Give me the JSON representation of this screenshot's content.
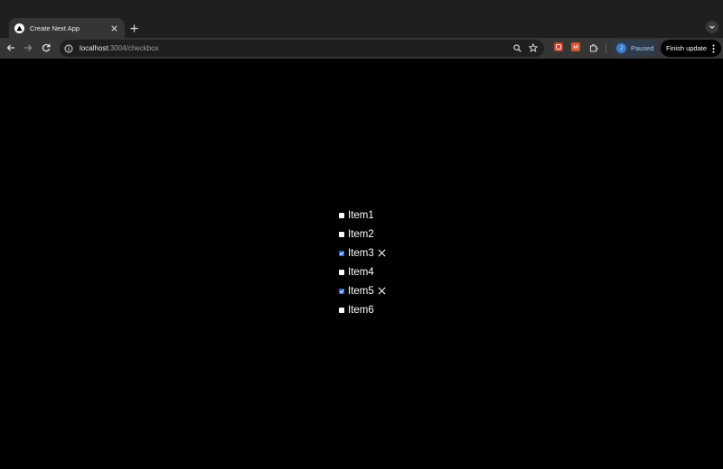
{
  "browser": {
    "tab": {
      "title": "Create Next App",
      "favicon": "triangle-icon"
    },
    "toolbar": {
      "url_host": "localhost",
      "url_path": ":3004/checkbox",
      "profile_initial": "J",
      "profile_status": "Paused",
      "update_label": "Finish update"
    },
    "colors": {
      "tab_strip": "#1f1f1f",
      "toolbar": "#353535",
      "omnibox": "#1f1f1f",
      "profile_chip": "#2f3a4a",
      "avatar": "#3c7ecf",
      "checkbox_checked": "#2f6ad9"
    }
  },
  "page": {
    "background": "#000000",
    "items": [
      {
        "label": "Item1",
        "checked": false
      },
      {
        "label": "Item2",
        "checked": false
      },
      {
        "label": "Item3",
        "checked": true
      },
      {
        "label": "Item4",
        "checked": false
      },
      {
        "label": "Item5",
        "checked": true
      },
      {
        "label": "Item6",
        "checked": false
      }
    ]
  }
}
